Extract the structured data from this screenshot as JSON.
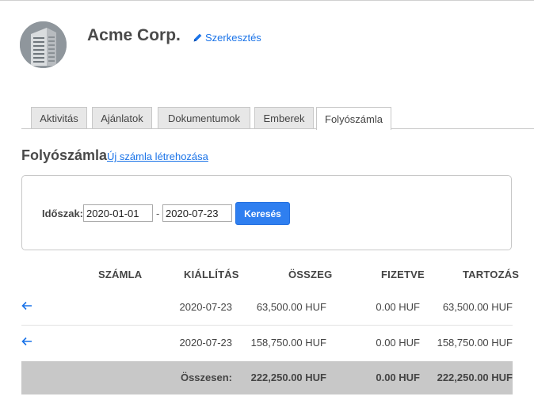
{
  "header": {
    "company_name": "Acme Corp.",
    "edit_label": "Szerkesztés"
  },
  "tabs": [
    {
      "label": "Aktivitás",
      "active": false
    },
    {
      "label": "Ajánlatok",
      "active": false
    },
    {
      "label": "Dokumentumok",
      "active": false
    },
    {
      "label": "Emberek",
      "active": false
    },
    {
      "label": "Folyószámla",
      "active": true
    }
  ],
  "section": {
    "title": "Folyószámla",
    "new_invoice_link": "Új számla létrehozása"
  },
  "filter": {
    "label": "Időszak:",
    "from_date": "2020-01-01",
    "separator": "-",
    "to_date": "2020-07-23",
    "search_button": "Keresés"
  },
  "table": {
    "columns": [
      "SZÁMLA",
      "KIÁLLÍTÁS",
      "ÖSSZEG",
      "FIZETVE",
      "TARTOZÁS"
    ],
    "rows": [
      {
        "issued": "2020-07-23",
        "amount": "63,500.00 HUF",
        "paid": "0.00 HUF",
        "due": "63,500.00 HUF"
      },
      {
        "issued": "2020-07-23",
        "amount": "158,750.00 HUF",
        "paid": "0.00 HUF",
        "due": "158,750.00 HUF"
      }
    ],
    "total": {
      "label": "Összesen:",
      "amount": "222,250.00 HUF",
      "paid": "0.00 HUF",
      "due": "222,250.00 HUF"
    }
  },
  "colors": {
    "link": "#1a73e8",
    "button": "#2f7ff0",
    "total_row": "#c8c8c8"
  }
}
